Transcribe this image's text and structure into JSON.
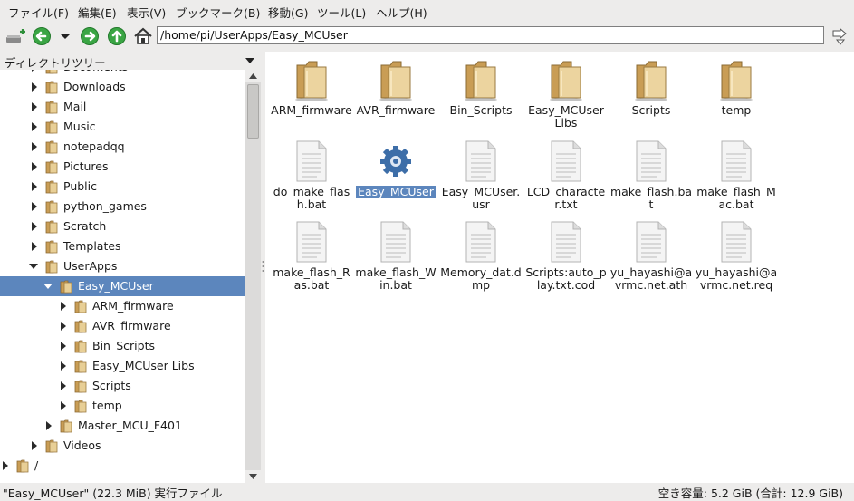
{
  "menu": [
    "ファイル(F)",
    "編集(E)",
    "表示(V)",
    "ブックマーク(B)",
    "移動(G)",
    "ツール(L)",
    "ヘルプ(H)"
  ],
  "address": "/home/pi/UserApps/Easy_MCUser",
  "sidebar": {
    "title": "ディレクトリツリー",
    "rows": [
      {
        "label": "Documents",
        "depth": 1,
        "state": "closed",
        "selected": false
      },
      {
        "label": "Downloads",
        "depth": 1,
        "state": "closed",
        "selected": false
      },
      {
        "label": "Mail",
        "depth": 1,
        "state": "closed",
        "selected": false
      },
      {
        "label": "Music",
        "depth": 1,
        "state": "closed",
        "selected": false
      },
      {
        "label": "notepadqq",
        "depth": 1,
        "state": "closed",
        "selected": false
      },
      {
        "label": "Pictures",
        "depth": 1,
        "state": "closed",
        "selected": false
      },
      {
        "label": "Public",
        "depth": 1,
        "state": "closed",
        "selected": false
      },
      {
        "label": "python_games",
        "depth": 1,
        "state": "closed",
        "selected": false
      },
      {
        "label": "Scratch",
        "depth": 1,
        "state": "closed",
        "selected": false
      },
      {
        "label": "Templates",
        "depth": 1,
        "state": "closed",
        "selected": false
      },
      {
        "label": "UserApps",
        "depth": 1,
        "state": "open",
        "selected": false
      },
      {
        "label": "Easy_MCUser",
        "depth": 2,
        "state": "open",
        "selected": true
      },
      {
        "label": "ARM_firmware",
        "depth": 3,
        "state": "closed",
        "selected": false
      },
      {
        "label": "AVR_firmware",
        "depth": 3,
        "state": "closed",
        "selected": false
      },
      {
        "label": "Bin_Scripts",
        "depth": 3,
        "state": "closed",
        "selected": false
      },
      {
        "label": "Easy_MCUser Libs",
        "depth": 3,
        "state": "closed",
        "selected": false
      },
      {
        "label": "Scripts",
        "depth": 3,
        "state": "closed",
        "selected": false
      },
      {
        "label": "temp",
        "depth": 3,
        "state": "closed",
        "selected": false
      },
      {
        "label": "Master_MCU_F401",
        "depth": 2,
        "state": "closed",
        "selected": false
      },
      {
        "label": "Videos",
        "depth": 1,
        "state": "closed",
        "selected": false
      },
      {
        "label": "/",
        "depth": 0,
        "state": "closed",
        "selected": false
      }
    ]
  },
  "files": [
    {
      "name": "ARM_firmware",
      "kind": "folder"
    },
    {
      "name": "AVR_firmware",
      "kind": "folder"
    },
    {
      "name": "Bin_Scripts",
      "kind": "folder"
    },
    {
      "name": "Easy_MCUser Libs",
      "kind": "folder"
    },
    {
      "name": "Scripts",
      "kind": "folder"
    },
    {
      "name": "temp",
      "kind": "folder"
    },
    {
      "name": "do_make_flash.bat",
      "kind": "file"
    },
    {
      "name": "Easy_MCUser",
      "kind": "exec",
      "selected": true
    },
    {
      "name": "Easy_MCUser.usr",
      "kind": "file"
    },
    {
      "name": "LCD_character.txt",
      "kind": "file"
    },
    {
      "name": "make_flash.bat",
      "kind": "file"
    },
    {
      "name": "make_flash_Mac.bat",
      "kind": "file"
    },
    {
      "name": "make_flash_Ras.bat",
      "kind": "file"
    },
    {
      "name": "make_flash_Win.bat",
      "kind": "file"
    },
    {
      "name": "Memory_dat.dmp",
      "kind": "file"
    },
    {
      "name": "Scripts:auto_play.txt.cod",
      "kind": "file"
    },
    {
      "name": "yu_hayashi@avrmc.net.ath",
      "kind": "file"
    },
    {
      "name": "yu_hayashi@avrmc.net.req",
      "kind": "file"
    }
  ],
  "status": {
    "left": "\"Easy_MCUser\" (22.3 MiB) 実行ファイル",
    "right": "空き容量: 5.2 GiB (合計: 12.9 GiB)"
  },
  "colors": {
    "selection": "#5c86bd",
    "folder": "#d8b677",
    "arrow_green": "#3aa544"
  }
}
